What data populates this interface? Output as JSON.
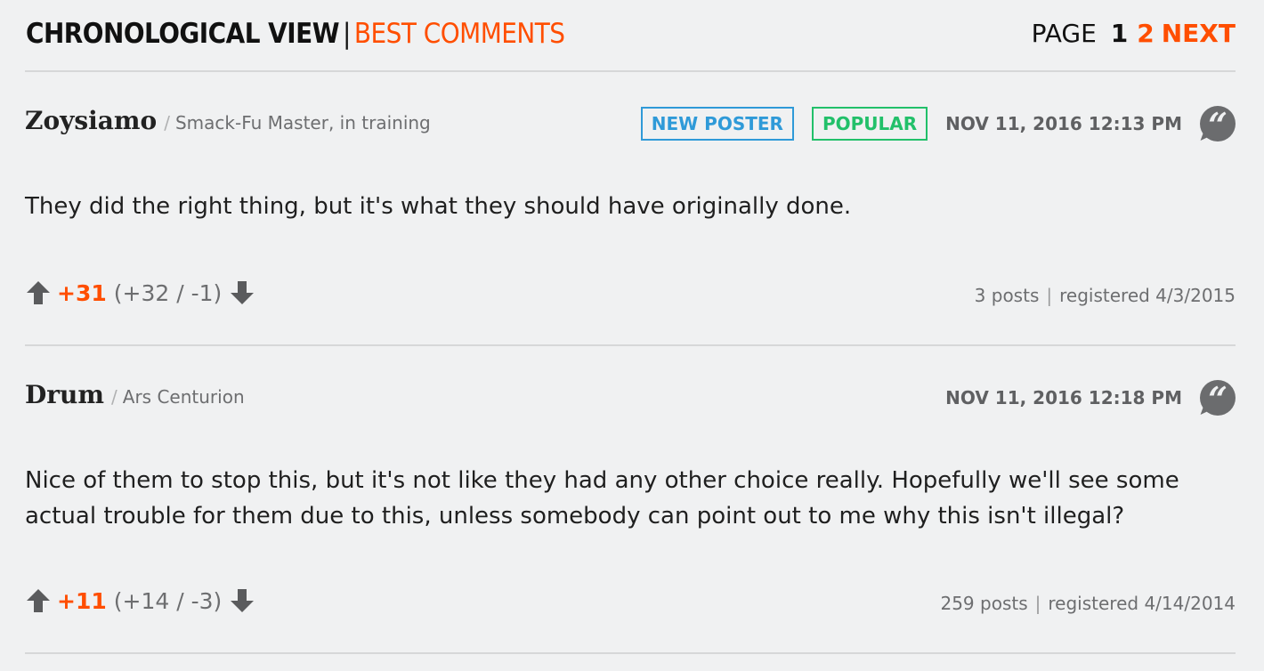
{
  "header": {
    "tab_active": "CHRONOLOGICAL VIEW",
    "tab_separator": "|",
    "tab_link": "BEST COMMENTS",
    "page_label": "PAGE",
    "page_current": "1",
    "page_link": "2",
    "next_label": "NEXT"
  },
  "comments": [
    {
      "author": "Zoysiamo",
      "rank_sep": "/",
      "rank": "Smack-Fu Master, in training",
      "badges": [
        "NEW POSTER",
        "POPULAR"
      ],
      "timestamp": "NOV 11, 2016 12:13 PM",
      "body": "They did the right thing, but it's what they should have originally done.",
      "score": "+31",
      "breakdown": "(+32 / -1)",
      "posts": "3 posts",
      "registered": "registered 4/3/2015"
    },
    {
      "author": "Drum",
      "rank_sep": "/",
      "rank": "Ars Centurion",
      "timestamp": "NOV 11, 2016 12:18 PM",
      "body": "Nice of them to stop this, but it's not like they had any other choice really. Hopefully we'll see some actual trouble for them due to this, unless somebody can point out to me why this isn't illegal?",
      "score": "+11",
      "breakdown": "(+14 / -3)",
      "posts": "259 posts",
      "registered": "registered 4/14/2014"
    }
  ],
  "stats_separator": "|",
  "quote_glyph": "“",
  "colors": {
    "accent": "#ff4e00",
    "new_poster": "#2f9ad8",
    "popular": "#22c06a",
    "background": "#f0f1f2"
  },
  "icons": {
    "upvote": "upvote-arrow-icon",
    "downvote": "downvote-arrow-icon",
    "quote": "quote-bubble-icon"
  }
}
